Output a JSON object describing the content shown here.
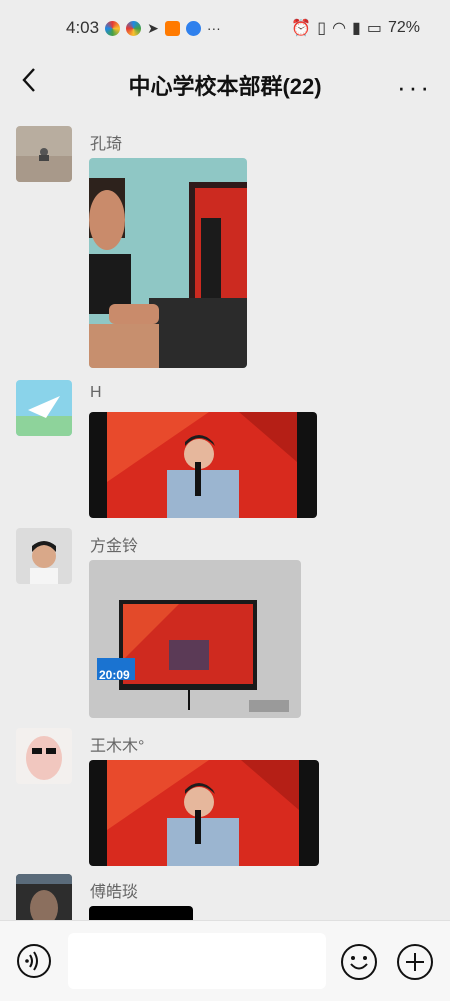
{
  "status": {
    "time": "4:03",
    "battery": "72%",
    "more": "···"
  },
  "chat": {
    "title": "中心学校本部群(22)",
    "more": "···"
  },
  "messages": [
    {
      "sender": "孔琦",
      "media": "photo of man watching broadcast on monitor"
    },
    {
      "sender": "H",
      "media": "photo of TV news anchor"
    },
    {
      "sender": "方金铃",
      "media": "photo of wall-mounted TV",
      "overlay_time": "20:09"
    },
    {
      "sender": "王木木°",
      "media": "photo of TV news anchor"
    },
    {
      "sender": "傅皓琰",
      "media": "photo (partially visible)"
    }
  ],
  "input": {
    "placeholder": ""
  },
  "icons": [
    "back-icon",
    "more-icon",
    "voice-icon",
    "emoji-icon",
    "plus-icon"
  ]
}
